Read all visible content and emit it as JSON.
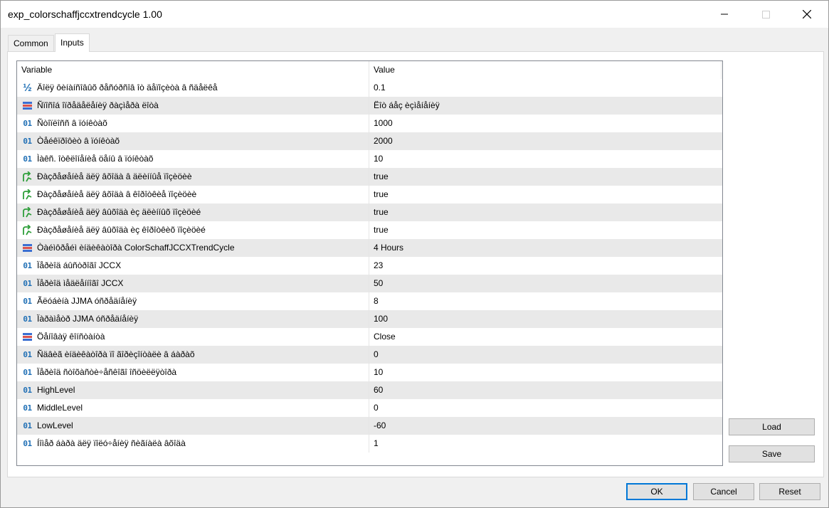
{
  "window": {
    "title": "exp_colorschaffjccxtrendcycle 1.00"
  },
  "tabs": [
    {
      "label": "Common"
    },
    {
      "label": "Inputs"
    }
  ],
  "table": {
    "headers": {
      "variable": "Variable",
      "value": "Value"
    },
    "rows": [
      {
        "icon": "fraction-icon",
        "name": "Äîëÿ ôèíàíñîâûõ ðåñóðñîâ îò äåïîçèòà â ñäåëêå",
        "value": "0.1"
      },
      {
        "icon": "enum-icon",
        "name": "Ñïîñîá îïðåäåëåíèÿ ðàçìåðà ëîòà",
        "value": "Ëîò áåç èçìåíåíèÿ"
      },
      {
        "icon": "integer-icon",
        "name": "Ñòîïëîññ â ïóíêòàõ",
        "value": "1000"
      },
      {
        "icon": "integer-icon",
        "name": "Òåéêïðîôèò â ïóíêòàõ",
        "value": "2000"
      },
      {
        "icon": "integer-icon",
        "name": "Ìàêñ. îòêëîíåíèå öåíû â ïóíêòàõ",
        "value": "10"
      },
      {
        "icon": "bool-icon",
        "name": "Ðàçðåøåíèå äëÿ âõîäà â äëèííûå ïîçèöèè",
        "value": "true"
      },
      {
        "icon": "bool-icon",
        "name": "Ðàçðåøåíèå äëÿ âõîäà â êîðîòêèå ïîçèöèè",
        "value": "true"
      },
      {
        "icon": "bool-icon",
        "name": "Ðàçðåøåíèå äëÿ âûõîäà èç äëèííûõ ïîçèöèé",
        "value": "true"
      },
      {
        "icon": "bool-icon",
        "name": "Ðàçðåøåíèå äëÿ âûõîäà èç êîðîòêèõ ïîçèöèé",
        "value": "true"
      },
      {
        "icon": "enum-icon",
        "name": "Òàéìôðåéì èíäèêàòîðà ColorSchaffJCCXTrendCycle",
        "value": "4 Hours"
      },
      {
        "icon": "integer-icon",
        "name": "Ïåðèîä áûñòðîãî JCCX",
        "value": "23"
      },
      {
        "icon": "integer-icon",
        "name": "Ïåðèîä ìåäëåííîãî JCCX",
        "value": "50"
      },
      {
        "icon": "integer-icon",
        "name": "Ãëóáèíà JJMA óñðåäíåíèÿ",
        "value": "8"
      },
      {
        "icon": "integer-icon",
        "name": "Ïàðàìåòð JJMA óñðåäíåíèÿ",
        "value": "100"
      },
      {
        "icon": "enum-icon",
        "name": "Öåíîâàÿ êîíñòàíòà",
        "value": "Close"
      },
      {
        "icon": "integer-icon",
        "name": "Ñäâèã èíäèêàòîðà ïî ãîðèçîíòàëè â áàðàõ",
        "value": "0"
      },
      {
        "icon": "integer-icon",
        "name": "Ïåðèîä ñòîõàñòè÷åñêîãî îñöèëëÿòîðà",
        "value": "10"
      },
      {
        "icon": "integer-icon",
        "name": "HighLevel",
        "value": "60"
      },
      {
        "icon": "integer-icon",
        "name": "MiddleLevel",
        "value": "0"
      },
      {
        "icon": "integer-icon",
        "name": "LowLevel",
        "value": "-60"
      },
      {
        "icon": "integer-icon",
        "name": "Íîìåð áàðà äëÿ ïîëó÷åíèÿ ñèãíàëà âõîäà",
        "value": "1"
      }
    ]
  },
  "side_buttons": {
    "load": "Load",
    "save": "Save"
  },
  "footer": {
    "ok": "OK",
    "cancel": "Cancel",
    "reset": "Reset"
  },
  "icons": {
    "fraction_glyph": "½",
    "integer_glyph": "01"
  },
  "colors": {
    "accent": "#0078d7",
    "integer_icon": "#1f6fb5",
    "bool_icon": "#2e9e3a",
    "enum_icon_red": "#d9534f",
    "enum_icon_blue": "#3b6fd1"
  }
}
